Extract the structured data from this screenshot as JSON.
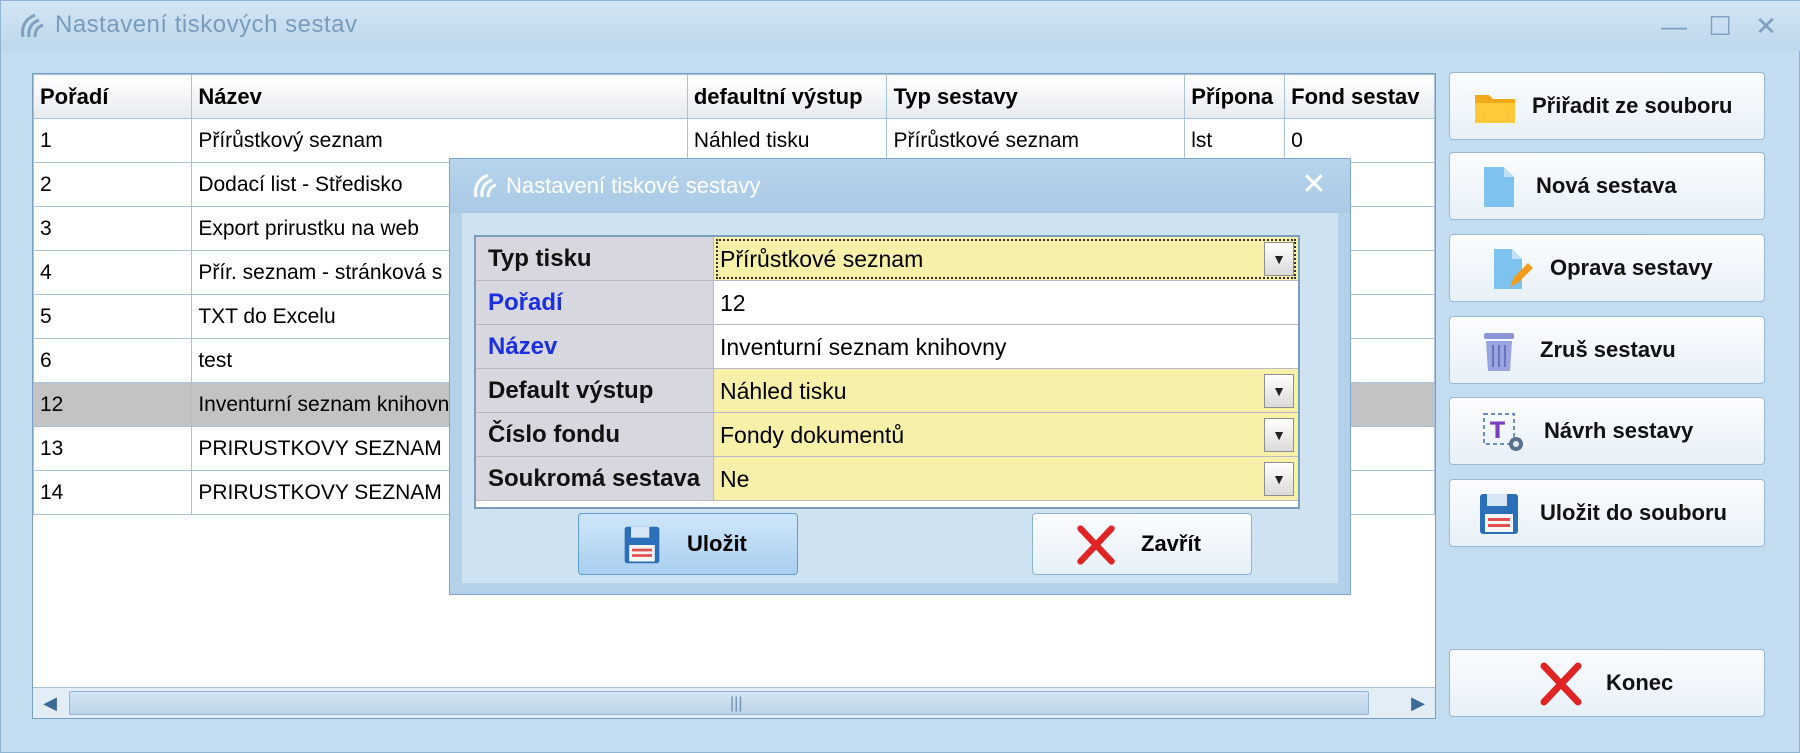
{
  "window": {
    "title": "Nastavení tiskových sestav",
    "minimize": "—",
    "maximize": "☐",
    "close": "✕"
  },
  "table": {
    "columns": [
      "Pořadí",
      "Název",
      "defaultní výstup",
      "Typ sestavy",
      "Přípona",
      "Fond sestav"
    ],
    "rows": [
      [
        "1",
        "Přírůstkový seznam",
        "Náhled tisku",
        "Přírůstkové seznam",
        "lst",
        "0"
      ],
      [
        "2",
        "Dodací list - Středisko",
        "",
        "",
        "",
        ""
      ],
      [
        "3",
        "Export prirustku na web",
        "",
        "",
        "",
        ""
      ],
      [
        "4",
        "Přír. seznam - stránková s",
        "",
        "",
        "",
        ""
      ],
      [
        "5",
        "TXT do Excelu",
        "",
        "",
        "",
        ""
      ],
      [
        "6",
        "test",
        "",
        "",
        "",
        ""
      ],
      [
        "12",
        "Inventurní seznam knihovny",
        "",
        "",
        "",
        ""
      ],
      [
        "13",
        "PRIRUSTKOVY SEZNAM NA",
        "",
        "",
        "",
        ""
      ],
      [
        "14",
        "PRIRUSTKOVY SEZNAM KO",
        "",
        "",
        "",
        ""
      ]
    ],
    "selected_row": 6,
    "scroll": {
      "left_arrow": "◀",
      "right_arrow": "▶",
      "grip": "|||"
    }
  },
  "sidebar": {
    "assign_from_file": "Přiřadit ze souboru",
    "new_report": "Nová sestava",
    "edit_report": "Oprava sestavy",
    "delete_report": "Zruš sestavu",
    "design_report": "Návrh sestavy",
    "save_to_file": "Uložit do souboru",
    "exit": "Konec"
  },
  "dialog": {
    "title": "Nastavení tiskové sestavy",
    "close": "✕",
    "fields": {
      "print_type": {
        "label": "Typ tisku",
        "value": "Přírůstkové seznam"
      },
      "order": {
        "label": "Pořadí",
        "value": "12"
      },
      "name": {
        "label": "Název",
        "value": "Inventurní seznam knihovny"
      },
      "default_output": {
        "label": "Default výstup",
        "value": "Náhled tisku"
      },
      "fund_number": {
        "label": "Číslo fondu",
        "value": "Fondy dokumentů"
      },
      "private_report": {
        "label": "Soukromá sestava",
        "value": "Ne"
      }
    },
    "dropdown_arrow": "▼",
    "save_label": "Uložit",
    "close_label": "Zavřít"
  },
  "colors": {
    "window_bg": "#c4dcef",
    "selected_row": "#c3c3c3",
    "field_highlight": "#f6f0a8",
    "required_label": "#1b2fe0",
    "close_red": "#e02424"
  }
}
